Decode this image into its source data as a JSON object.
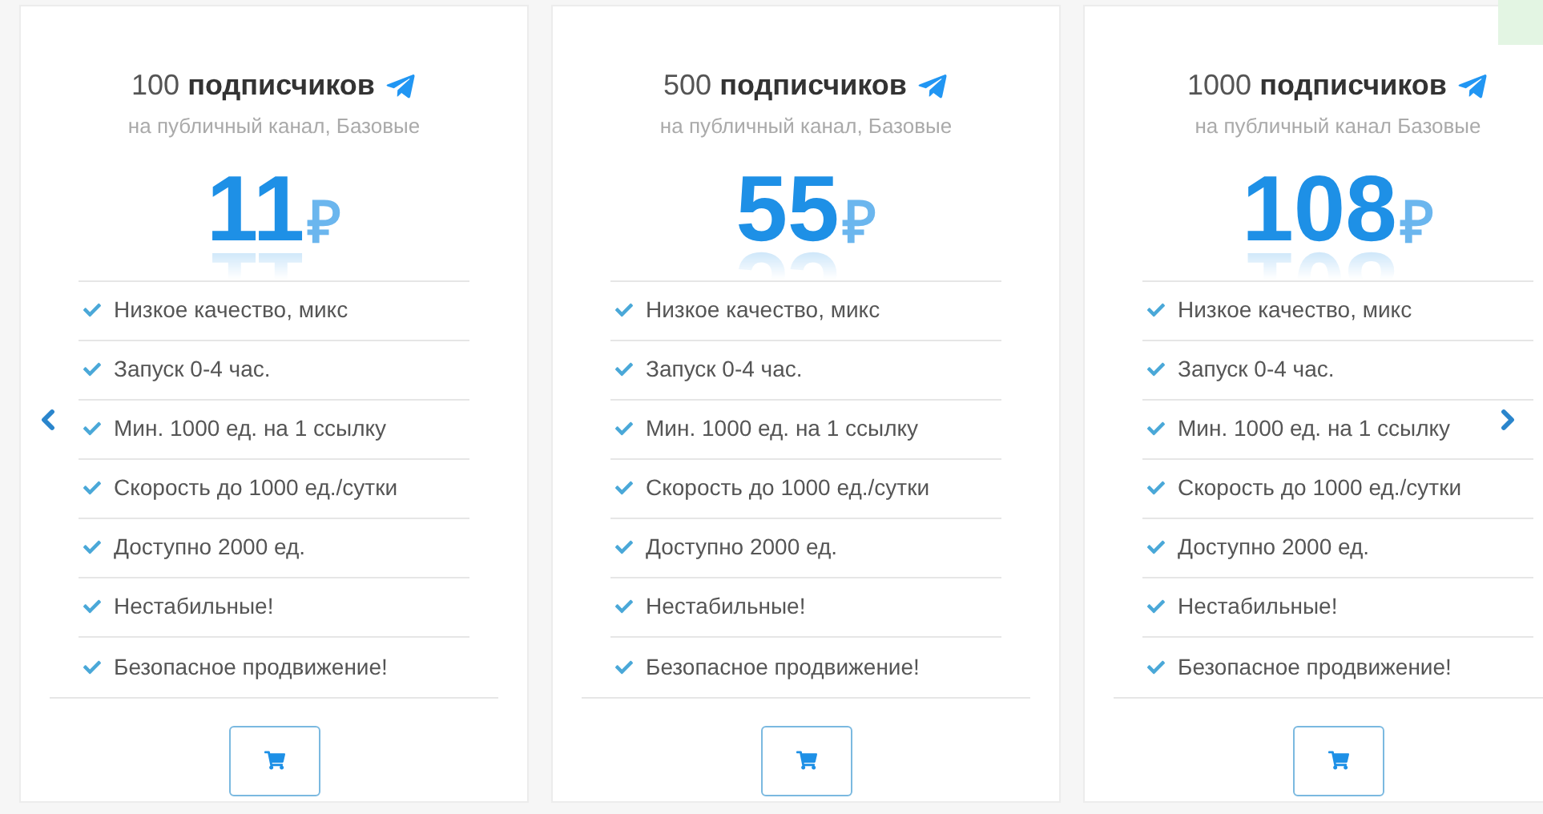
{
  "plans": [
    {
      "count": "100",
      "title_word": "подписчиков",
      "subtitle": "на публичный канал, Базовые",
      "price": "11",
      "currency": "₽",
      "features": [
        "Низкое качество, микс",
        "Запуск 0-4 час.",
        "Мин. 1000 ед. на 1 ссылку",
        "Скорость до 1000 ед./сутки",
        "Доступно 2000 ед.",
        "Нестабильные!",
        "Безопасное продвижение!"
      ]
    },
    {
      "count": "500",
      "title_word": "подписчиков",
      "subtitle": "на публичный канал, Базовые",
      "price": "55",
      "currency": "₽",
      "features": [
        "Низкое качество, микс",
        "Запуск 0-4 час.",
        "Мин. 1000 ед. на 1 ссылку",
        "Скорость до 1000 ед./сутки",
        "Доступно 2000 ед.",
        "Нестабильные!",
        "Безопасное продвижение!"
      ]
    },
    {
      "count": "1000",
      "title_word": "подписчиков",
      "subtitle": "на публичный канал Базовые",
      "price": "108",
      "currency": "₽",
      "features": [
        "Низкое качество, микс",
        "Запуск 0-4 час.",
        "Мин. 1000 ед. на 1 ссылку",
        "Скорость до 1000 ед./сутки",
        "Доступно 2000 ед.",
        "Нестабильные!",
        "Безопасное продвижение!"
      ]
    }
  ]
}
